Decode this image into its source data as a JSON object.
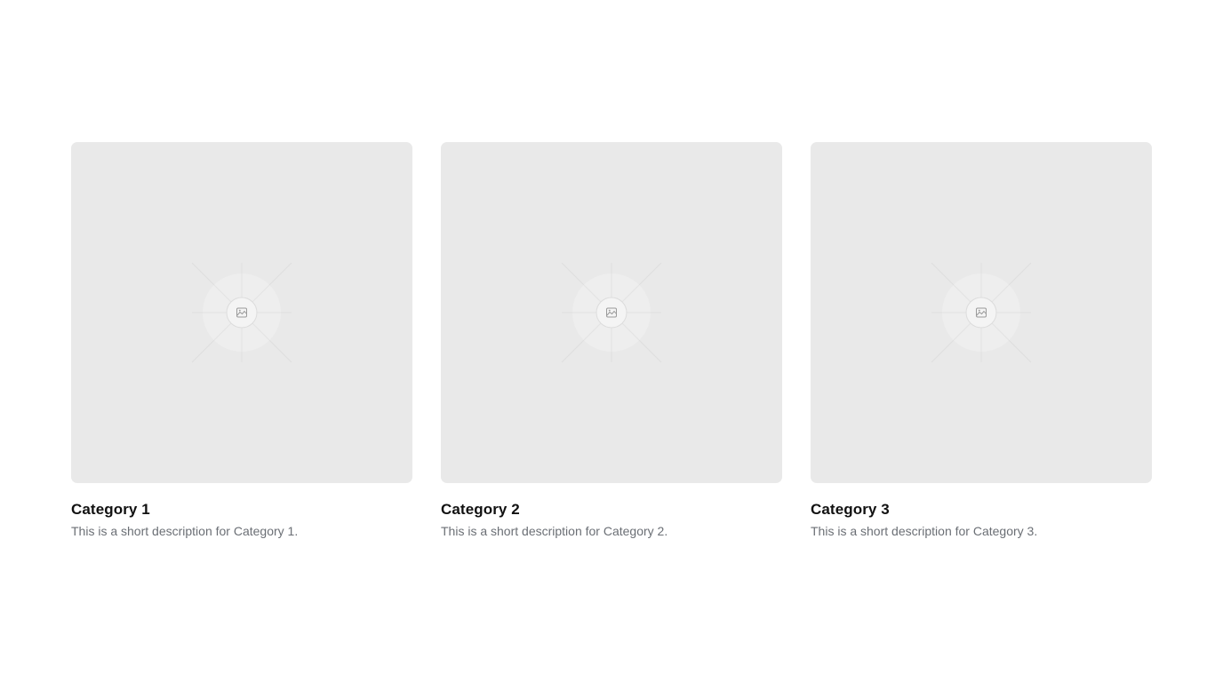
{
  "cards": [
    {
      "title": "Category 1",
      "description": "This is a short description for Category 1.",
      "image_icon": "image-placeholder-icon"
    },
    {
      "title": "Category 2",
      "description": "This is a short description for Category 2.",
      "image_icon": "image-placeholder-icon"
    },
    {
      "title": "Category 3",
      "description": "This is a short description for Category 3.",
      "image_icon": "image-placeholder-icon"
    }
  ],
  "colors": {
    "placeholder_bg": "#e9e9e9",
    "title": "#111111",
    "description": "#6b6f75"
  }
}
